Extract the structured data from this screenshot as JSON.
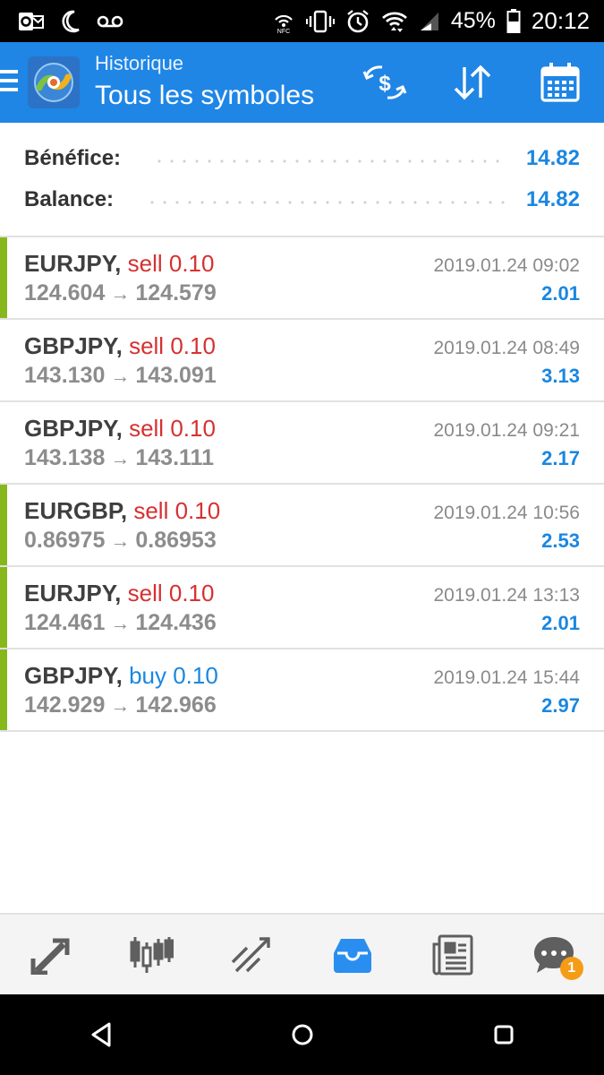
{
  "status_bar": {
    "battery": "45%",
    "time": "20:12",
    "left_icons": [
      "outlook-icon",
      "moon-icon",
      "voicemail-icon"
    ],
    "right_icons": [
      "nfc-icon",
      "vibrate-icon",
      "alarm-icon",
      "wifi-icon",
      "signal-icon",
      "battery-icon"
    ]
  },
  "header": {
    "subtitle": "Historique",
    "title": "Tous les symboles",
    "actions": [
      "currency-exchange-icon",
      "sort-icon",
      "calendar-icon"
    ]
  },
  "summary": {
    "profit_label": "Bénéfice:",
    "profit_value": "14.82",
    "balance_label": "Balance:",
    "balance_value": "14.82"
  },
  "trades": [
    {
      "symbol": "EURJPY,",
      "side": "sell",
      "lot": "0.10",
      "open": "124.604",
      "close": "124.579",
      "date": "2019.01.24 09:02",
      "profit": "2.01",
      "accent": true
    },
    {
      "symbol": "GBPJPY,",
      "side": "sell",
      "lot": "0.10",
      "open": "143.130",
      "close": "143.091",
      "date": "2019.01.24 08:49",
      "profit": "3.13",
      "accent": false
    },
    {
      "symbol": "GBPJPY,",
      "side": "sell",
      "lot": "0.10",
      "open": "143.138",
      "close": "143.111",
      "date": "2019.01.24 09:21",
      "profit": "2.17",
      "accent": false
    },
    {
      "symbol": "EURGBP,",
      "side": "sell",
      "lot": "0.10",
      "open": "0.86975",
      "close": "0.86953",
      "date": "2019.01.24 10:56",
      "profit": "2.53",
      "accent": true
    },
    {
      "symbol": "EURJPY,",
      "side": "sell",
      "lot": "0.10",
      "open": "124.461",
      "close": "124.436",
      "date": "2019.01.24 13:13",
      "profit": "2.01",
      "accent": true
    },
    {
      "symbol": "GBPJPY,",
      "side": "buy",
      "lot": "0.10",
      "open": "142.929",
      "close": "142.966",
      "date": "2019.01.24 15:44",
      "profit": "2.97",
      "accent": true
    }
  ],
  "arrow_glyph": "→",
  "bottom_nav": {
    "items": [
      "quotes-icon",
      "chart-icon",
      "trade-icon",
      "history-icon",
      "news-icon",
      "chat-icon"
    ],
    "active": "history-icon",
    "chat_badge": "1"
  },
  "system_nav": [
    "back-icon",
    "home-icon",
    "recents-icon"
  ],
  "colors": {
    "header_bg": "#1f86e6",
    "accent_green": "#86b81e",
    "sell_red": "#d63131",
    "buy_blue": "#1a87e0",
    "badge_orange": "#f59c17"
  }
}
